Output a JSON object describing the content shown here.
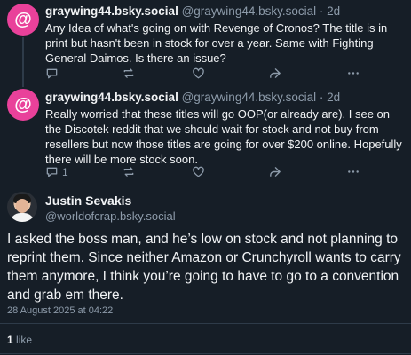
{
  "replies": [
    {
      "avatar_glyph": "@",
      "display_name": "graywing44.bsky.social",
      "handle": "@graywing44.bsky.social",
      "separator": "·",
      "time": "2d",
      "text": "Any Idea of what's going on with Revenge of Cronos? The title is in print but hasn't been in stock for over a year. Same with Fighting General Daimos. Is there an issue?",
      "reply_count": "",
      "repost_count": "",
      "like_count": ""
    },
    {
      "avatar_glyph": "@",
      "display_name": "graywing44.bsky.social",
      "handle": "@graywing44.bsky.social",
      "separator": "·",
      "time": "2d",
      "text": "Really worried that these titles will go OOP(or already are). I see on the Discotek reddit that we should wait for stock and not buy from resellers but now those titles are going for over $200 online. Hopefully there will be more stock soon.",
      "reply_count": "1",
      "repost_count": "",
      "like_count": ""
    }
  ],
  "main_post": {
    "display_name": "Justin Sevakis",
    "handle": "@worldofcrap.bsky.social",
    "text": "I asked the boss man, and he’s low on stock and not planning to reprint them. Since neither Amazon or Crunchyroll wants to carry them anymore, I think you’re going to have to go to a convention and grab em there.",
    "timestamp": "28 August 2025 at 04:22",
    "like_count": "1",
    "like_label": "like"
  },
  "first_reply_count_shown": "1",
  "colors": {
    "background": "#161e27",
    "avatar_pink": "#e9419a",
    "text": "#f1f3f5",
    "muted": "#8d9baa",
    "divider": "#2e3b49"
  },
  "icons": [
    "reply-icon",
    "repost-icon",
    "like-icon",
    "more-icon"
  ]
}
